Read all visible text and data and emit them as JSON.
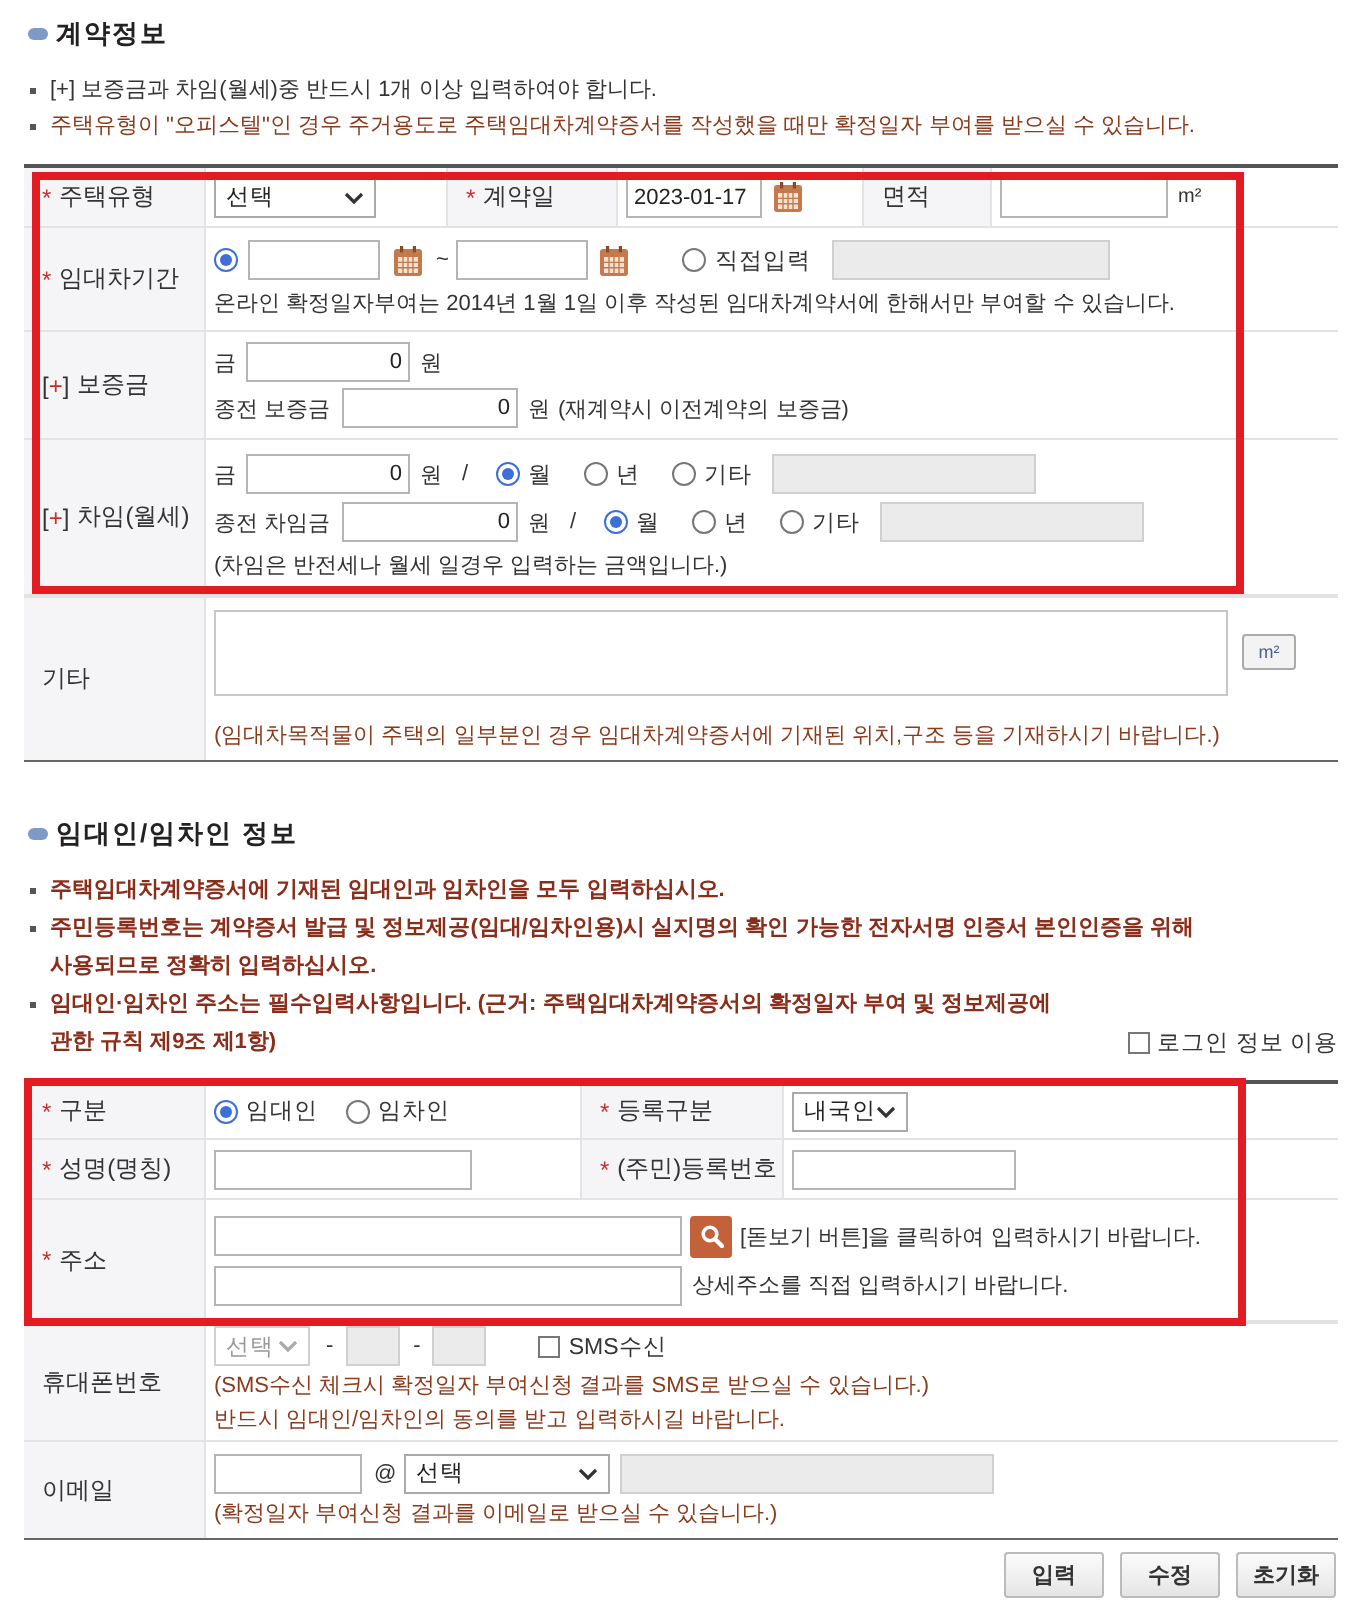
{
  "contract_section": {
    "title": "계약정보",
    "notes": [
      {
        "kind": "plain",
        "text": "[+] 보증금과 차임(월세)중 반드시 1개 이상 입력하여야 합니다."
      },
      {
        "kind": "caution",
        "text": "주택유형이 \"오피스텔\"인 경우 주거용도로 주택임대차계약증서를 작성했을 때만 확정일자 부여를 받으실 수 있습니다."
      }
    ],
    "highlighted_rows": {
      "house_type": {
        "label": {
          "mark": "*",
          "text": "주택유형"
        },
        "select": {
          "value": "선택",
          "disabled": false
        },
        "date_label": {
          "mark": "*",
          "text": "계약일"
        },
        "date": "2023-01-17",
        "area_label": {
          "text": "면적"
        },
        "area_unit": "m²"
      },
      "lease_period": {
        "label": {
          "mark": "*",
          "text": "임대차기간"
        },
        "range_option": {
          "selected": true
        },
        "separator": "~",
        "direct_option": {
          "label": "직접입력",
          "selected": false
        },
        "direct_field": {
          "disabled": true
        },
        "note": "온라인 확정일자부여는 2014년 1월 1일 이후 작성된 임대차계약서에 한해서만 부여할 수 있습니다."
      },
      "deposit": {
        "label": {
          "mark": "[+]",
          "text": "보증금"
        },
        "amount_label": "금",
        "amount": "0",
        "amount_unit": "원",
        "previous_label": "종전 보증금",
        "previous_amount": "0",
        "previous_unit": "원",
        "previous_note": "(재계약시 이전계약의 보증금)"
      },
      "rent": {
        "label": {
          "mark": "[+]",
          "text": "차임(월세)"
        },
        "lines": [
          {
            "label": "금",
            "amount": "0",
            "unit": "원",
            "slash": "/",
            "periods": [
              {
                "label": "월",
                "selected": true
              },
              {
                "label": "년",
                "selected": false
              },
              {
                "label": "기타",
                "selected": false
              }
            ],
            "other_field": {
              "disabled": true
            }
          },
          {
            "label": "종전 차임금",
            "amount": "0",
            "unit": "원",
            "slash": "/",
            "periods": [
              {
                "label": "월",
                "selected": true
              },
              {
                "label": "년",
                "selected": false
              },
              {
                "label": "기타",
                "selected": false
              }
            ],
            "other_field": {
              "disabled": true
            }
          }
        ],
        "note": "(차임은 반전세나 월세 일경우 입력하는 금액입니다.)"
      }
    },
    "remarks": {
      "label": {
        "text": "기타"
      },
      "unit_button": "m²",
      "note": "(임대차목적물이 주택의 일부분인 경우 임대차계약증서에 기재된 위치,구조 등을 기재하시기 바랍니다.)"
    }
  },
  "party_section": {
    "title": "임대인/임차인 정보",
    "notes": [
      {
        "kind": "alert",
        "text": "주택임대차계약증서에 기재된 임대인과 임차인을 모두 입력하십시오."
      },
      {
        "kind": "alert",
        "text": "주민등록번호는 계약증서 발급 및 정보제공(임대/임차인용)시 실지명의 확인 가능한 전자서명 인증서 본인인증을 위해 사용되므로 정확히 입력하십시오."
      },
      {
        "kind": "alert",
        "text": "임대인·임차인 주소는 필수입력사항입니다. (근거: 주택임대차계약증서의 확정일자 부여 및 정보제공에 관한 규칙 제9조 제1항)"
      }
    ],
    "login_checkbox": {
      "label": "로그인 정보 이용",
      "checked": false
    },
    "highlighted_rows": {
      "party_type": {
        "label": {
          "mark": "*",
          "text": "구분"
        },
        "options": [
          {
            "label": "임대인",
            "selected": true
          },
          {
            "label": "임차인",
            "selected": false
          }
        ],
        "registration_label": {
          "mark": "*",
          "text": "등록구분"
        },
        "registration_select": {
          "value": "내국인",
          "disabled": false
        }
      },
      "name": {
        "label": {
          "mark": "*",
          "text": "성명(명칭)"
        },
        "id_label": {
          "mark": "*",
          "text": "(주민)등록번호"
        }
      },
      "address": {
        "label": {
          "mark": "*",
          "text": "주소"
        },
        "search_hint": "[돋보기 버튼]을 클릭하여 입력하시기 바랍니다.",
        "detail_hint": "상세주소를 직접 입력하시기 바랍니다."
      }
    },
    "phone": {
      "label": {
        "text": "휴대폰번호"
      },
      "prefix_select": {
        "value": "선택",
        "disabled": true
      },
      "separators": [
        "-",
        "-"
      ],
      "middle_field": {
        "disabled": true
      },
      "last_field": {
        "disabled": true
      },
      "sms_checkbox": {
        "label": "SMS수신",
        "checked": false
      },
      "notes": [
        "(SMS수신 체크시 확정일자 부여신청 결과를 SMS로 받으실 수 있습니다.)",
        "반드시 임대인/임차인의 동의를 받고 입력하시길 바랍니다."
      ]
    },
    "email": {
      "label": {
        "text": "이메일"
      },
      "at": "@",
      "domain_select": {
        "value": "선택",
        "disabled": false
      },
      "domain_field": {
        "disabled": true
      },
      "note": "(확정일자 부여신청 결과를 이메일로 받으실 수 있습니다.)"
    }
  },
  "buttons": [
    "입력",
    "수정",
    "초기화"
  ]
}
